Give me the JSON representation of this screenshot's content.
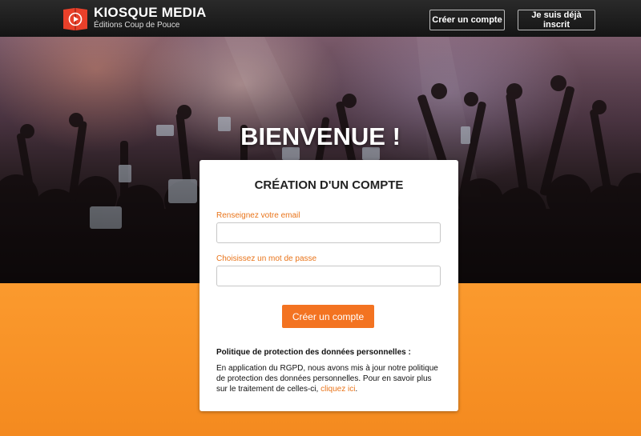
{
  "header": {
    "brand_name": "KIOSQUE MEDIA",
    "brand_sub": "Éditions Coup de Pouce",
    "create_account_label": "Créer un compte",
    "login_label": "Je suis déjà inscrit"
  },
  "hero": {
    "title": "BIENVENUE !"
  },
  "form": {
    "title": "CRÉATION D'UN COMPTE",
    "email_label": "Renseignez votre email",
    "email_value": "",
    "password_label": "Choisissez un mot de passe",
    "password_value": "",
    "submit_label": "Créer un compte"
  },
  "policy": {
    "title": "Politique de protection des données personnelles :",
    "text": "En application du RGPD, nous avons mis à jour notre politique de protection des données personnelles. Pour en savoir plus sur le traitement de celles-ci, ",
    "link_label": "cliquez ici",
    "text_end": "."
  },
  "colors": {
    "accent": "#f37321",
    "header_bg": "#1a1a1a",
    "bottom_bg": "#f48a1f"
  }
}
